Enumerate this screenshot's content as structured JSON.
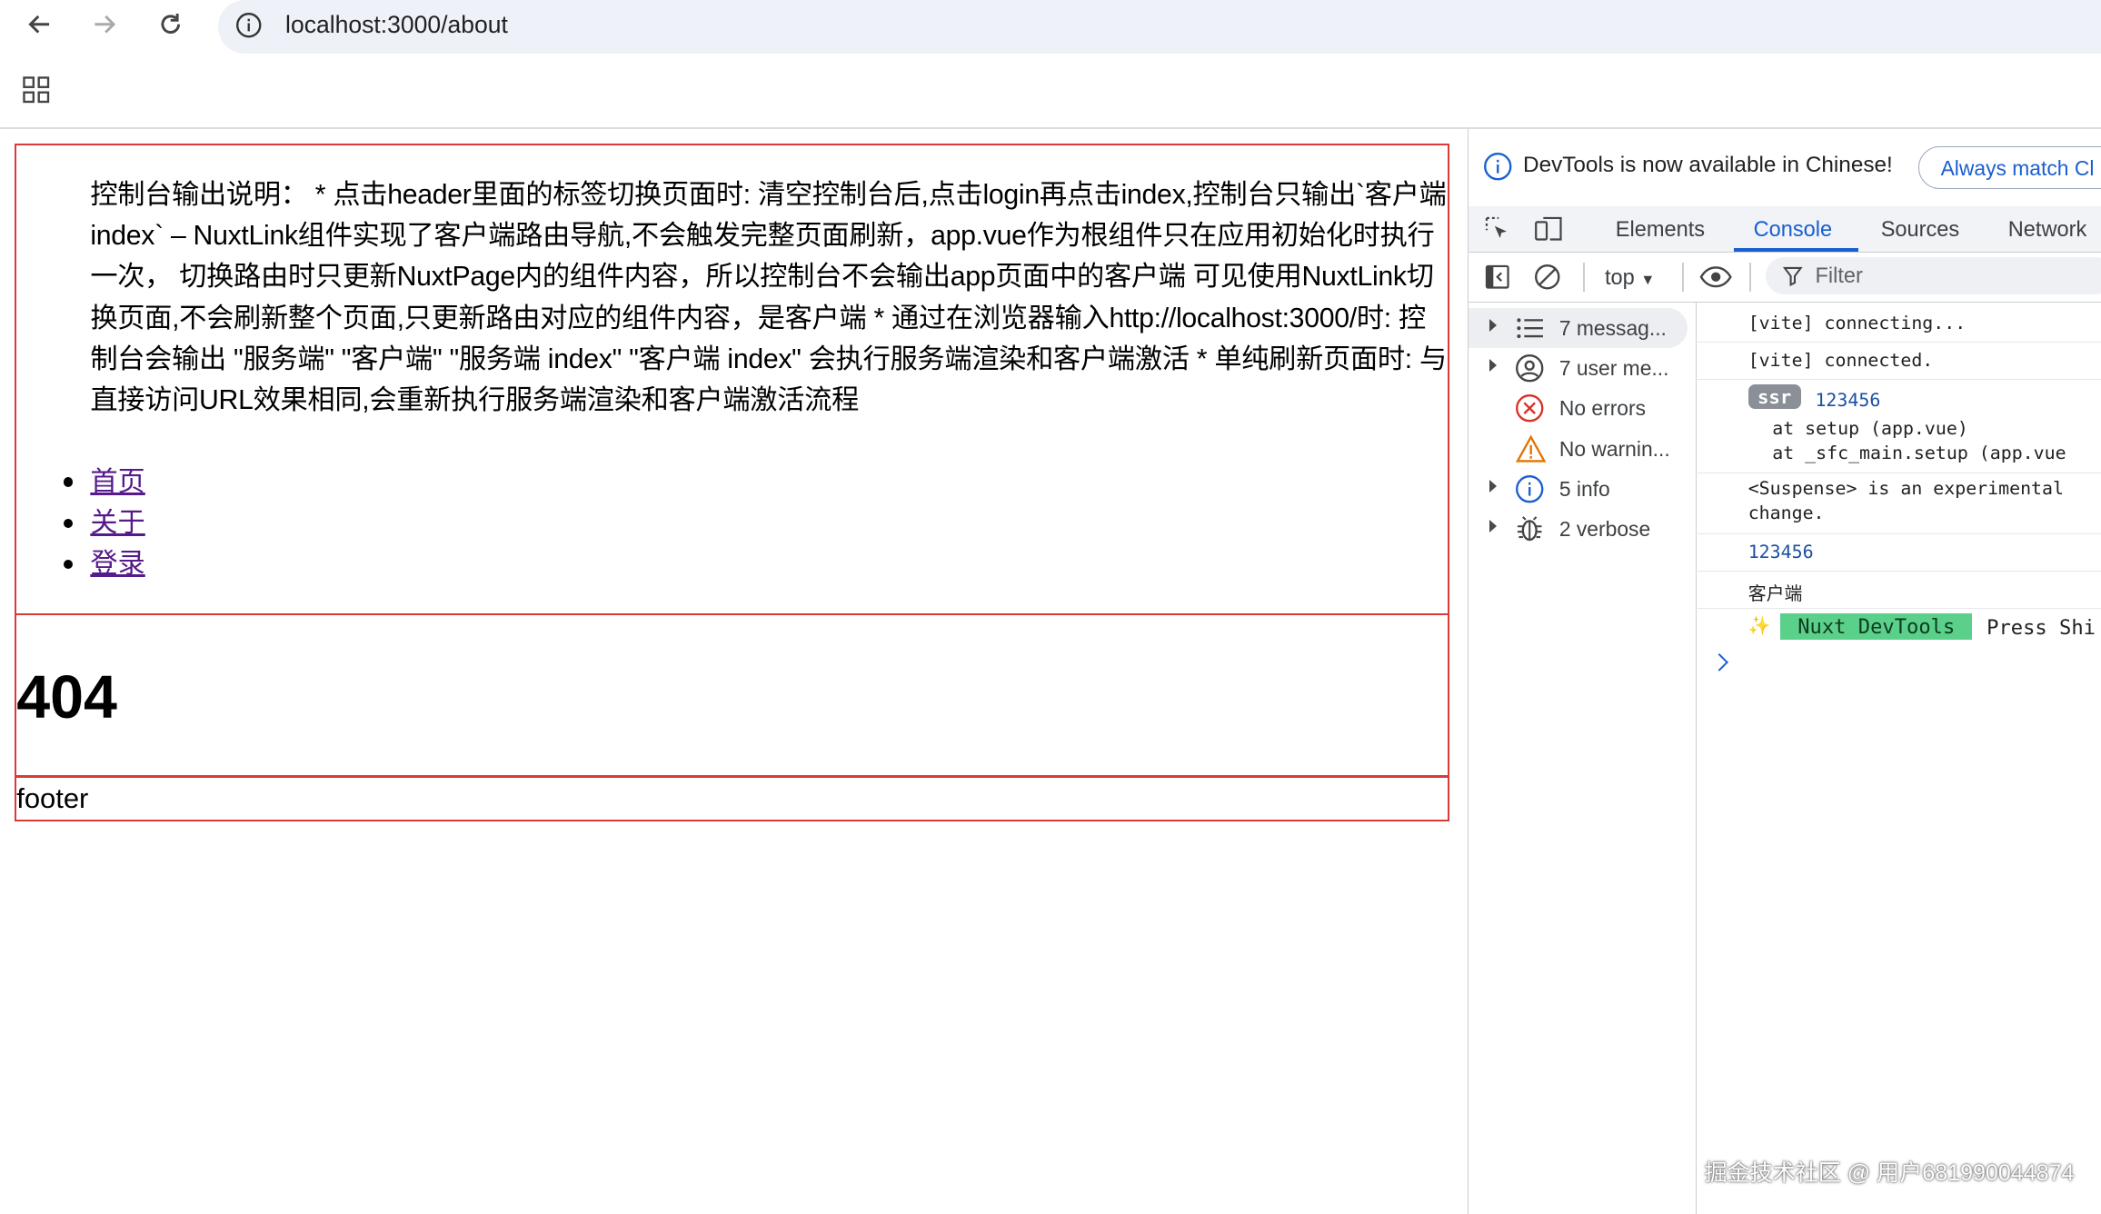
{
  "browser": {
    "url": "localhost:3000/about"
  },
  "page": {
    "description": "控制台输出说明：  * 点击header里面的标签切换页面时: 清空控制台后,点击login再点击index,控制台只输出`客户端 index` – NuxtLink组件实现了客户端路由导航,不会触发完整页面刷新，app.vue作为根组件只在应用初始化时执行一次， 切换路由时只更新NuxtPage内的组件内容，所以控制台不会输出app页面中的客户端 可见使用NuxtLink切换页面,不会刷新整个页面,只更新路由对应的组件内容，是客户端 * 通过在浏览器输入http://localhost:3000/时: 控制台会输出 \"服务端\" \"客户端\" \"服务端 index\" \"客户端 index\" 会执行服务端渲染和客户端激活 * 单纯刷新页面时: 与直接访问URL效果相同,会重新执行服务端渲染和客户端激活流程",
    "nav_links": [
      "首页",
      "关于",
      "登录"
    ],
    "main_heading": "404",
    "footer_text": "footer"
  },
  "devtools": {
    "banner_text": "DevTools is now available in Chinese!",
    "banner_button": "Always match Cl",
    "tabs": [
      "Elements",
      "Console",
      "Sources",
      "Network"
    ],
    "active_tab": "Console",
    "context": "top",
    "filter_placeholder": "Filter",
    "sidebar": [
      {
        "label": "7 messag...",
        "icon": "list-icon"
      },
      {
        "label": "7 user me...",
        "icon": "user-icon"
      },
      {
        "label": "No errors",
        "icon": "error-icon"
      },
      {
        "label": "No warnin...",
        "icon": "warning-icon"
      },
      {
        "label": "5 info",
        "icon": "info-icon"
      },
      {
        "label": "2 verbose",
        "icon": "bug-icon"
      }
    ],
    "console": {
      "line1": "[vite] connecting...",
      "line2": "[vite] connected.",
      "ssr_badge": "ssr",
      "ssr_value": "123456",
      "stack1": "at setup (app.vue)",
      "stack2": "at _sfc_main.setup (app.vue",
      "suspense1": "<Suspense> is an experimental",
      "suspense2": "change.",
      "value": "123456",
      "client": "客户端",
      "nuxt_badge": "Nuxt DevTools",
      "nuxt_text": "Press Shi"
    }
  },
  "watermark": "掘金技术社区 @ 用户681990044874"
}
